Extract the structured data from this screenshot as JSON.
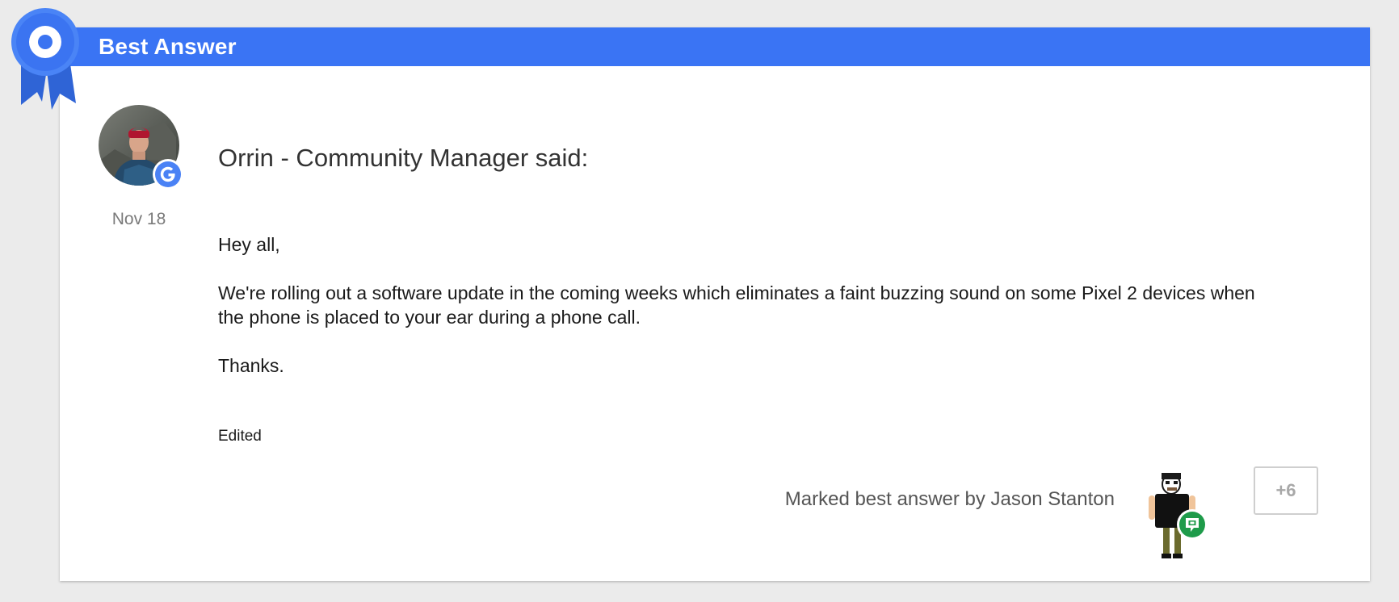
{
  "banner": {
    "title": "Best Answer",
    "color": "#3a74f4",
    "icon": "award-ribbon-icon"
  },
  "post": {
    "author_line": "Orrin - Community Manager said:",
    "date": "Nov 18",
    "avatar_icon": "user-avatar",
    "badge_icon": "google-g-icon",
    "paragraphs": [
      "Hey all,",
      "We're rolling out a software update in the coming weeks which eliminates a faint buzzing sound on some Pixel 2 devices when the phone is placed to your ear during a phone call.",
      "Thanks."
    ],
    "edited_label": "Edited"
  },
  "footer": {
    "marked_text": "Marked best answer by Jason Stanton",
    "marker_avatar_icon": "android-avatar",
    "marker_badge_icon": "hangouts-icon",
    "plus_label": "+6"
  }
}
